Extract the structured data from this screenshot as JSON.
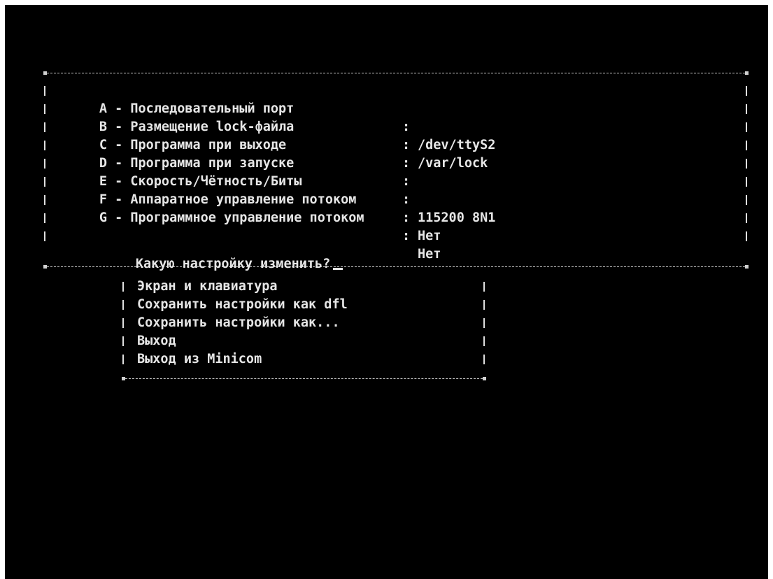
{
  "config_panel": {
    "items": [
      {
        "key": "A",
        "label": "A - Последовательный порт",
        "value": "/dev/ttyS2"
      },
      {
        "key": "B",
        "label": "B - Размещение lock-файла",
        "value": "/var/lock"
      },
      {
        "key": "C",
        "label": "C - Программа при выходе",
        "value": ""
      },
      {
        "key": "D",
        "label": "D - Программа при запуске",
        "value": ""
      },
      {
        "key": "E",
        "label": "E - Скорость/Чётность/Биты",
        "value": "115200 8N1"
      },
      {
        "key": "F",
        "label": "F - Аппаратное управление потоком",
        "value": "Нет"
      },
      {
        "key": "G",
        "label": "G - Программное управление потоком",
        "value": "Нет"
      }
    ],
    "separator": ":",
    "prompt": "Какую настройку изменить?"
  },
  "menu": {
    "items": [
      "Экран и клавиатура",
      "Сохранить настройки как dfl",
      "Сохранить настройки как...",
      "Выход",
      "Выход из Minicom"
    ]
  },
  "colors": {
    "background": "#000000",
    "text": "#e6e6e6",
    "page": "#ffffff"
  }
}
